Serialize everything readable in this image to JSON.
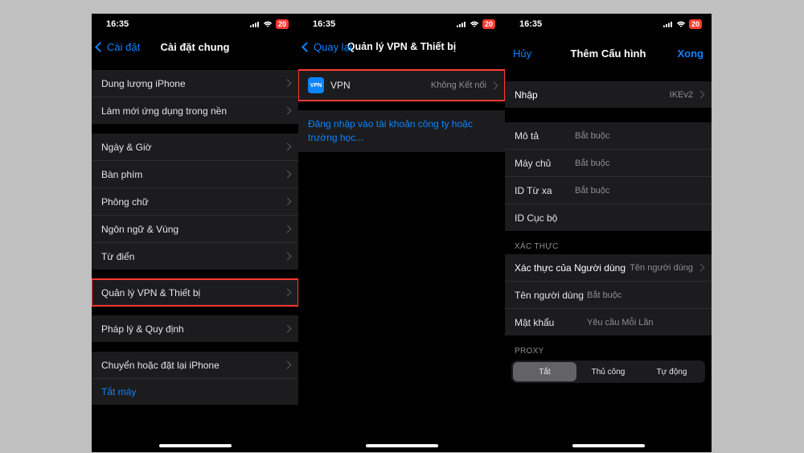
{
  "status": {
    "time": "16:35",
    "battery": "20"
  },
  "screen1": {
    "back": "Cài đặt",
    "title": "Cài đặt chung",
    "g1": [
      {
        "label": "Dung lượng iPhone"
      },
      {
        "label": "Làm mới ứng dụng trong nền"
      }
    ],
    "g2": [
      {
        "label": "Ngày & Giờ"
      },
      {
        "label": "Bàn phím"
      },
      {
        "label": "Phông chữ"
      },
      {
        "label": "Ngôn ngữ & Vùng"
      },
      {
        "label": "Từ điển"
      }
    ],
    "g3": [
      {
        "label": "Quản lý VPN & Thiết bị"
      }
    ],
    "g4": [
      {
        "label": "Pháp lý & Quy định"
      }
    ],
    "g5": [
      {
        "label": "Chuyển hoặc đặt lại iPhone"
      }
    ],
    "shutdown": "Tắt máy"
  },
  "screen2": {
    "back": "Quay lại",
    "title": "Quản lý VPN & Thiết bị",
    "vpn_badge": "VPN",
    "vpn_label": "VPN",
    "vpn_status": "Không Kết nối",
    "signin": "Đăng nhập vào tài khoản công ty hoặc trường học..."
  },
  "screen3": {
    "cancel": "Hủy",
    "title": "Thêm Cấu hình",
    "done": "Xong",
    "type_label": "Nhập",
    "type_value": "IKEv2",
    "fields": {
      "desc_label": "Mô tả",
      "desc_ph": "Bắt buộc",
      "server_label": "Máy chủ",
      "server_ph": "Bắt buộc",
      "remoteid_label": "ID Từ xa",
      "remoteid_ph": "Bắt buộc",
      "localid_label": "ID Cục bộ"
    },
    "auth_header": "XÁC THỰC",
    "auth": {
      "userauth_label": "Xác thực của Người dùng",
      "userauth_value": "Tên người dùng",
      "user_label": "Tên người dùng",
      "user_ph": "Bắt buộc",
      "pass_label": "Mật khẩu",
      "pass_ph": "Yêu cầu Mỗi Lần"
    },
    "proxy_header": "PROXY",
    "proxy": {
      "off": "Tắt",
      "manual": "Thủ công",
      "auto": "Tự động"
    }
  }
}
